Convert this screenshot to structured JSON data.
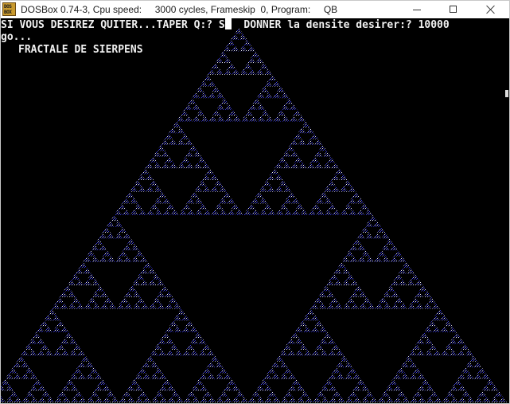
{
  "window": {
    "icon_text": "DOS\nBOX",
    "title": "DOSBox 0.74-3, Cpu speed:     3000 cycles, Frameskip  0, Program:     QB",
    "minimize_glyph": "minimize-icon",
    "maximize_glyph": "maximize-icon",
    "close_glyph": "close-icon"
  },
  "console": {
    "line1_prompt": "SI VOUS DESIREZ QUITER...TAPER Q:? S",
    "line1_rest": "  DONNER la densite desirer:? 10000",
    "line2": "go...",
    "line3": "FRACTALE DE SIERPENS"
  },
  "colors": {
    "background": "#000000",
    "text": "#f0f0f0",
    "fractal_blue": "#3a3ad8",
    "fractal_white": "#e8e8ff"
  },
  "fractal": {
    "name": "Sierpinski triangle",
    "density": 10000,
    "depth": 6
  }
}
